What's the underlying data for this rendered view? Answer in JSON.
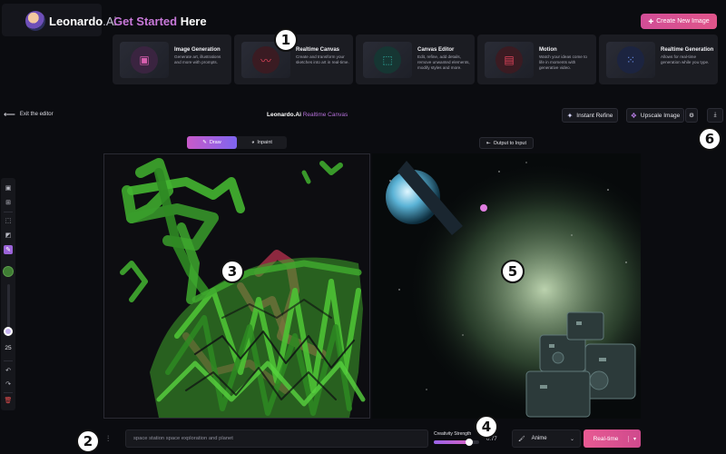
{
  "brand": {
    "name": "Leonardo",
    "suffix": ".Ai"
  },
  "header": {
    "get_started_a": "Get Started",
    "get_started_b": " Here",
    "create_button": "Create New Image",
    "create_icon": "plus-icon"
  },
  "cards": [
    {
      "title": "Image Generation",
      "description": "Generate art, illustrations and more with prompts.",
      "icon": "image-icon",
      "accent": "#d65fae"
    },
    {
      "title": "Realtime Canvas",
      "description": "Create and transform your sketches into art in real-time.",
      "icon": "brush-icon",
      "accent": "#e0445b"
    },
    {
      "title": "Canvas Editor",
      "description": "Edit, refine, add details, remove unwanted elements, modify styles and more.",
      "icon": "canvas-icon",
      "accent": "#2fb3a5"
    },
    {
      "title": "Motion",
      "description": "Watch your ideas come to life in moments with generative video.",
      "icon": "film-icon",
      "accent": "#e0445b"
    },
    {
      "title": "Realtime Generation",
      "description": "Allows for real-time generation while you type.",
      "icon": "grid-dots-icon",
      "accent": "#6a8de8"
    }
  ],
  "editor": {
    "exit_label": "Exit the editor",
    "title_main": "Leonardo.Ai",
    "title_sub": " Realtime Canvas",
    "instant_refine": "Instant Refine",
    "upscale": "Upscale Image",
    "output_to_input": "Output to Input"
  },
  "modes": {
    "draw": "Draw",
    "inpaint": "Inpaint",
    "active": "draw"
  },
  "toolbar": {
    "brush_size": "25",
    "color": "#3f7d34"
  },
  "prompt": {
    "text": "space station space exploration and planet",
    "creativity_label": "Creativity Strength",
    "creativity_value": "0.77",
    "style": "Anime",
    "generate_label": "Real-time"
  },
  "annotations": [
    "1",
    "2",
    "3",
    "4",
    "5",
    "6"
  ],
  "colors": {
    "accent_pink": "#e0558a",
    "accent_purple": "#9b63d8",
    "background": "#0b0c10"
  }
}
